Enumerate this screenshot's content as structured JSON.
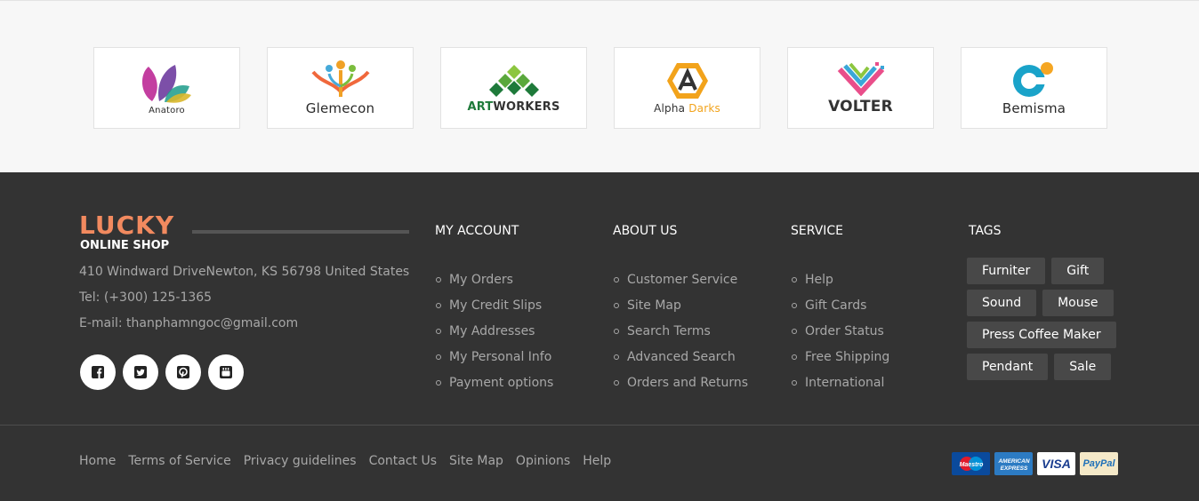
{
  "brands": [
    {
      "name": "Anatoro"
    },
    {
      "name": "Glemecon"
    },
    {
      "name": "ARTWORKERS",
      "part1": "ART",
      "part2": "WORKERS"
    },
    {
      "name": "Alpha Darks",
      "part1": "Alpha",
      "part2": "Darks"
    },
    {
      "name": "VOLTER"
    },
    {
      "name": "Bemisma"
    }
  ],
  "footer": {
    "logo": {
      "main": "LUCKY",
      "sub": "ONLINE SHOP"
    },
    "address": "410 Windward DriveNewton, KS 56798 United States",
    "tel": "Tel: (+300) 125-1365",
    "email": "E-mail: thanphamngoc@gmail.com",
    "socials": [
      "facebook-icon",
      "twitter-icon",
      "pinterest-icon",
      "youtube-icon"
    ],
    "my_account": {
      "title": "MY ACCOUNT",
      "items": [
        "My Orders",
        "My Credit Slips",
        "My Addresses",
        "My Personal Info",
        "Payment options"
      ]
    },
    "about_us": {
      "title": "ABOUT US",
      "items": [
        "Customer Service",
        "Site Map",
        "Search Terms",
        "Advanced Search",
        "Orders and Returns"
      ]
    },
    "service": {
      "title": "SERVICE",
      "items": [
        "Help",
        "Gift Cards",
        "Order Status",
        "Free Shipping",
        "International"
      ]
    },
    "tags": {
      "title": "TAGS",
      "items": [
        "Furniter",
        "Gift",
        "Sound",
        "Mouse",
        "Press Coffee Maker",
        "Pendant",
        "Sale"
      ]
    },
    "bottom_links": [
      "Home",
      "Terms of Service",
      "Privacy guidelines",
      "Contact Us",
      "Site Map",
      "Opinions",
      "Help"
    ],
    "payments": [
      {
        "name": "Maestro",
        "color": "#0a4a9c"
      },
      {
        "name": "AMERICAN EXPRESS",
        "color": "#2c7bc3"
      },
      {
        "name": "VISA",
        "color": "#1a3d8f"
      },
      {
        "name": "PayPal",
        "color": "#1d6fb8"
      }
    ]
  }
}
